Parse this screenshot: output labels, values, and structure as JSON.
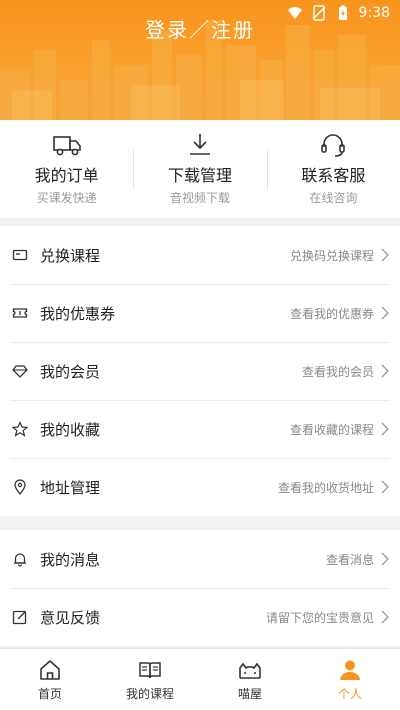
{
  "status_bar": {
    "time": "9:38"
  },
  "header": {
    "login_text": "登录／注册"
  },
  "quick_actions": [
    {
      "title": "我的订单",
      "subtitle": "买课发快递",
      "icon": "truck-icon"
    },
    {
      "title": "下载管理",
      "subtitle": "音视频下载",
      "icon": "download-icon"
    },
    {
      "title": "联系客服",
      "subtitle": "在线咨询",
      "icon": "headset-icon"
    }
  ],
  "menu_group_1": [
    {
      "label": "兑换课程",
      "hint": "兑换码兑换课程",
      "icon": "card-icon"
    },
    {
      "label": "我的优惠券",
      "hint": "查看我的优惠券",
      "icon": "ticket-icon"
    },
    {
      "label": "我的会员",
      "hint": "查看我的会员",
      "icon": "diamond-icon"
    },
    {
      "label": "我的收藏",
      "hint": "查看收藏的课程",
      "icon": "star-icon"
    },
    {
      "label": "地址管理",
      "hint": "查看我的收货地址",
      "icon": "location-icon"
    }
  ],
  "menu_group_2": [
    {
      "label": "我的消息",
      "hint": "查看消息",
      "icon": "bell-icon"
    },
    {
      "label": "意见反馈",
      "hint": "请留下您的宝贵意见",
      "icon": "edit-icon"
    }
  ],
  "bottom_nav": [
    {
      "label": "首页",
      "icon": "home-icon",
      "active": false
    },
    {
      "label": "我的课程",
      "icon": "book-icon",
      "active": false
    },
    {
      "label": "喵屋",
      "icon": "cat-icon",
      "active": false
    },
    {
      "label": "个人",
      "icon": "person-icon",
      "active": true
    }
  ],
  "colors": {
    "accent": "#f7941d",
    "text": "#222222",
    "hint": "#888888"
  }
}
